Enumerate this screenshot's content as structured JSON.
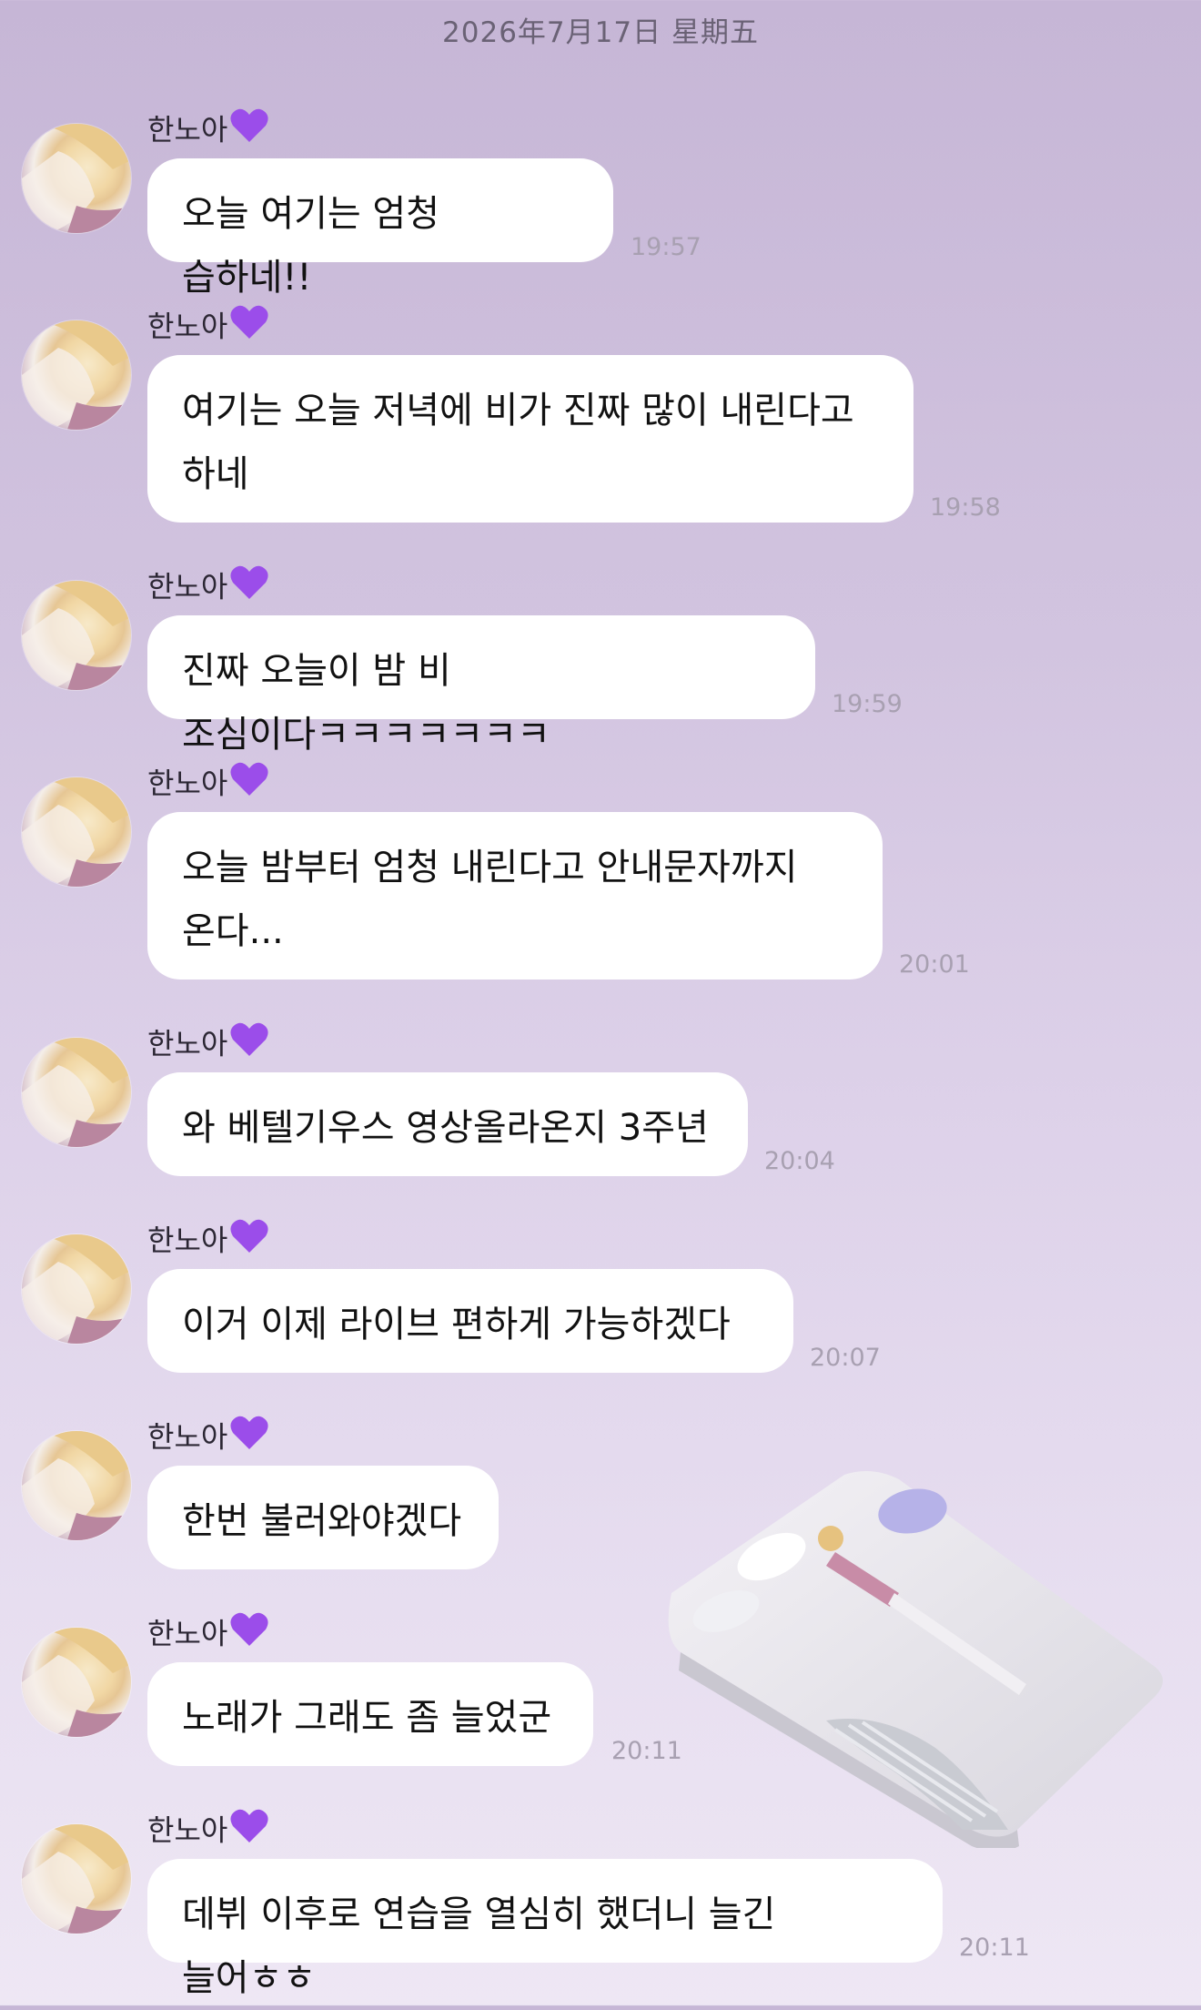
{
  "date_header": "2026年7月17日 星期五",
  "sender": {
    "name": "한노아",
    "heart_icon": "purple-heart-emoji",
    "heart_color": "#9b4dea"
  },
  "messages": [
    {
      "text": "오늘 여기는 엄청 습하네!!",
      "time": "19:57"
    },
    {
      "text": "여기는 오늘 저녁에 비가 진짜 많이 내린다고 하네",
      "time": "19:58"
    },
    {
      "text": "진짜 오늘이 밤 비 조심이다ㅋㅋㅋㅋㅋㅋㅋ",
      "time": "19:59"
    },
    {
      "text": "오늘 밤부터 엄청 내린다고 안내문자까지 온다...",
      "time": "20:01"
    },
    {
      "text": "와 베텔기우스 영상올라온지 3주년",
      "time": "20:04"
    },
    {
      "text": "이거 이제 라이브 편하게 가능하겠다",
      "time": "20:07"
    },
    {
      "text": "한번 불러와야겠다",
      "time": ""
    },
    {
      "text": "노래가 그래도 좀 늘었군",
      "time": "20:11"
    },
    {
      "text": "데뷔 이후로 연습을 열심히 했더니 늘긴 늘어ㅎㅎ",
      "time": "20:11"
    }
  ],
  "sticker": {
    "icon": "bed-character-sticker"
  }
}
